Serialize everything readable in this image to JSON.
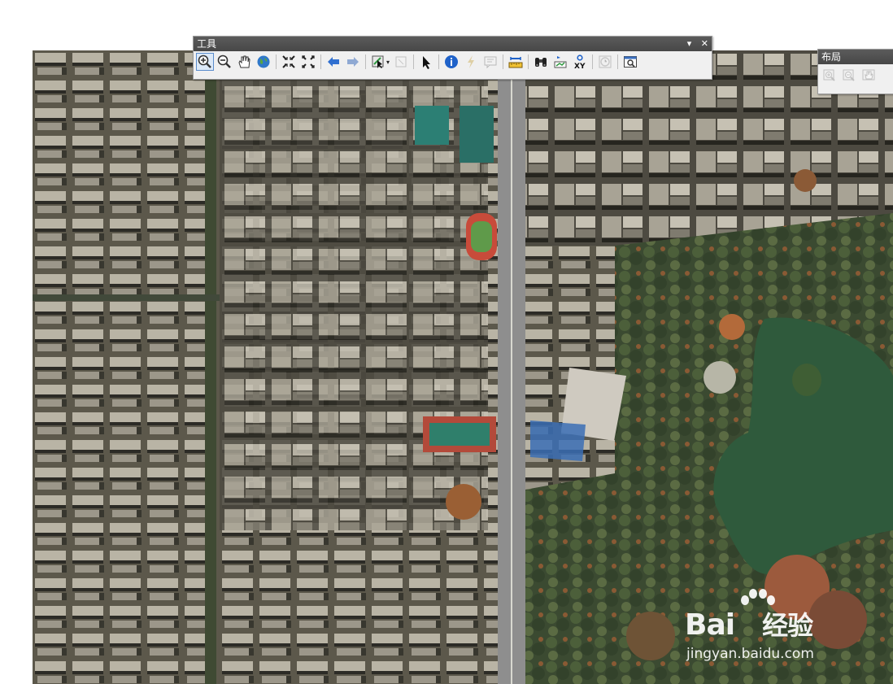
{
  "tools_toolbar": {
    "title": "工具",
    "minimize_glyph": "▾",
    "close_glyph": "✕",
    "buttons": [
      {
        "name": "zoom-in-icon",
        "state": "selected"
      },
      {
        "name": "zoom-out-icon",
        "state": "normal"
      },
      {
        "name": "pan-hand-icon",
        "state": "normal"
      },
      {
        "name": "full-extent-globe-icon",
        "state": "normal"
      },
      {
        "name": "fixed-zoom-in-icon",
        "state": "normal"
      },
      {
        "name": "fixed-zoom-out-icon",
        "state": "normal"
      },
      {
        "name": "back-arrow-icon",
        "state": "normal"
      },
      {
        "name": "forward-arrow-icon",
        "state": "normal"
      },
      {
        "name": "select-features-icon",
        "state": "normal"
      },
      {
        "name": "clear-selection-icon",
        "state": "disabled"
      },
      {
        "name": "select-elements-arrow-icon",
        "state": "normal"
      },
      {
        "name": "identify-info-icon",
        "state": "normal"
      },
      {
        "name": "hyperlink-lightning-icon",
        "state": "disabled"
      },
      {
        "name": "html-popup-icon",
        "state": "disabled"
      },
      {
        "name": "measure-ruler-icon",
        "state": "normal"
      },
      {
        "name": "find-binoculars-icon",
        "state": "normal"
      },
      {
        "name": "find-route-icon",
        "state": "normal"
      },
      {
        "name": "go-to-xy-icon",
        "state": "normal"
      },
      {
        "name": "time-slider-icon",
        "state": "disabled"
      },
      {
        "name": "viewer-window-icon",
        "state": "normal"
      }
    ],
    "xy_label": "XY"
  },
  "layout_toolbar": {
    "title": "布局",
    "buttons": [
      {
        "name": "layout-zoom-in-icon",
        "state": "disabled"
      },
      {
        "name": "layout-zoom-out-icon",
        "state": "disabled"
      },
      {
        "name": "layout-pan-icon",
        "state": "disabled"
      }
    ]
  },
  "watermark": {
    "brand": "Bai",
    "brand_cn": "经验",
    "url": "jingyan.baidu.com"
  },
  "colors": {
    "titlebar": "#4f4f4f",
    "selected_border": "#5a8ccc",
    "lake": "#2f5a3c",
    "road": "#8e8e8e",
    "sports_field": "#c84b3a"
  }
}
